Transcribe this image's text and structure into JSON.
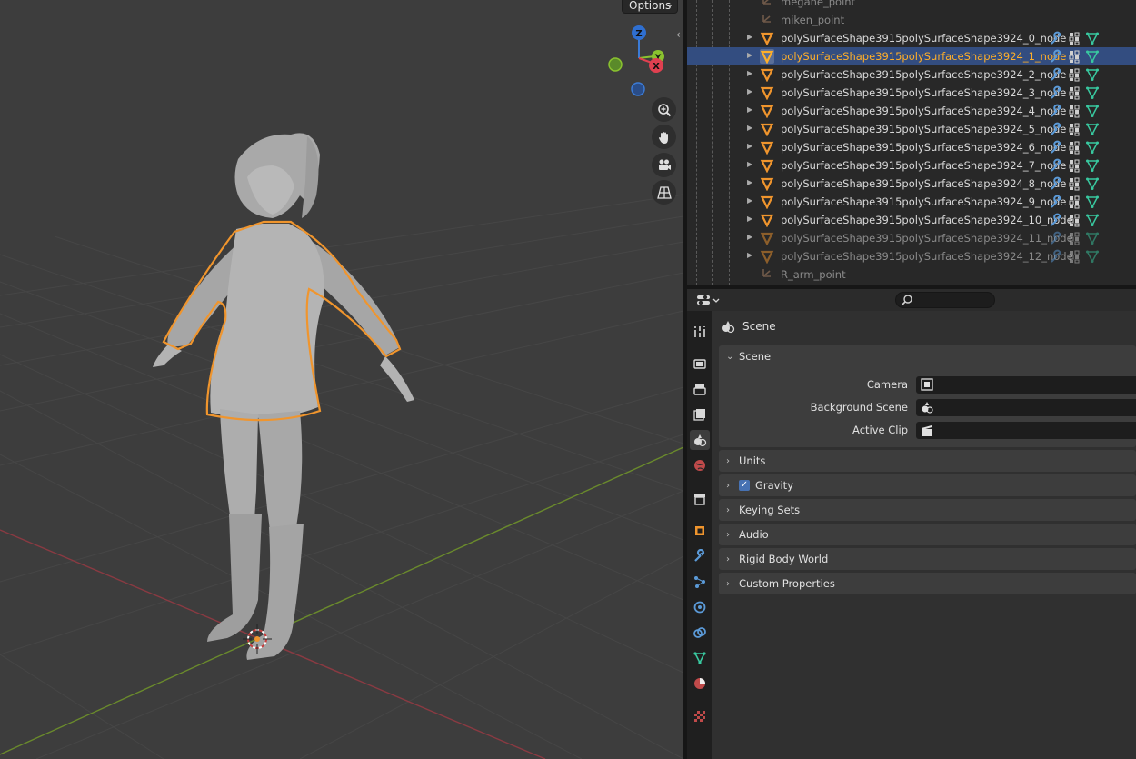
{
  "viewport": {
    "options_label": "Options",
    "gizmo_axes": {
      "z": "Z",
      "y": "Y",
      "x": "X"
    },
    "nav_tools": [
      "zoom-icon",
      "pan-hand-icon",
      "camera-view-icon",
      "ortho-grid-icon"
    ],
    "colors": {
      "background": "#3d3d3d",
      "x_axis": "#9e3b44",
      "y_axis": "#6c8f2e",
      "selection_outline": "#f0952d"
    }
  },
  "outliner": {
    "rows": [
      {
        "label": "megane_point",
        "type": "bone",
        "state": "dim"
      },
      {
        "label": "miken_point",
        "type": "bone",
        "state": "dim"
      },
      {
        "label": "polySurfaceShape3915polySurfaceShape3924_0_node",
        "type": "mesh",
        "state": "normal"
      },
      {
        "label": "polySurfaceShape3915polySurfaceShape3924_1_node",
        "type": "mesh",
        "state": "selected"
      },
      {
        "label": "polySurfaceShape3915polySurfaceShape3924_2_node",
        "type": "mesh",
        "state": "normal"
      },
      {
        "label": "polySurfaceShape3915polySurfaceShape3924_3_node",
        "type": "mesh",
        "state": "normal"
      },
      {
        "label": "polySurfaceShape3915polySurfaceShape3924_4_node",
        "type": "mesh",
        "state": "normal"
      },
      {
        "label": "polySurfaceShape3915polySurfaceShape3924_5_node",
        "type": "mesh",
        "state": "normal"
      },
      {
        "label": "polySurfaceShape3915polySurfaceShape3924_6_node",
        "type": "mesh",
        "state": "normal"
      },
      {
        "label": "polySurfaceShape3915polySurfaceShape3924_7_node",
        "type": "mesh",
        "state": "normal"
      },
      {
        "label": "polySurfaceShape3915polySurfaceShape3924_8_node",
        "type": "mesh",
        "state": "normal"
      },
      {
        "label": "polySurfaceShape3915polySurfaceShape3924_9_node",
        "type": "mesh",
        "state": "normal"
      },
      {
        "label": "polySurfaceShape3915polySurfaceShape3924_10_node",
        "type": "mesh",
        "state": "normal"
      },
      {
        "label": "polySurfaceShape3915polySurfaceShape3924_11_node",
        "type": "mesh",
        "state": "dim"
      },
      {
        "label": "polySurfaceShape3915polySurfaceShape3924_12_node",
        "type": "mesh",
        "state": "dim"
      },
      {
        "label": "R_arm_point",
        "type": "bone",
        "state": "dim"
      }
    ]
  },
  "properties": {
    "search_placeholder": "",
    "context_label": "Scene",
    "tabs": [
      "tool",
      "render",
      "output",
      "view-layer",
      "scene",
      "world",
      "collection",
      "object",
      "modifiers",
      "particles",
      "physics",
      "constraints",
      "data",
      "material",
      "texture"
    ],
    "active_tab": "scene",
    "scene_panel": {
      "title": "Scene",
      "fields": [
        {
          "label": "Camera",
          "icon": "camera-object-icon",
          "value": ""
        },
        {
          "label": "Background Scene",
          "icon": "scene-icon",
          "value": ""
        },
        {
          "label": "Active Clip",
          "icon": "movie-clip-icon",
          "value": ""
        }
      ]
    },
    "collapsed_panels": [
      {
        "title": "Units",
        "checkbox": false
      },
      {
        "title": "Gravity",
        "checkbox": true
      },
      {
        "title": "Keying Sets",
        "checkbox": false
      },
      {
        "title": "Audio",
        "checkbox": false
      },
      {
        "title": "Rigid Body World",
        "checkbox": false
      },
      {
        "title": "Custom Properties",
        "checkbox": false
      }
    ]
  }
}
